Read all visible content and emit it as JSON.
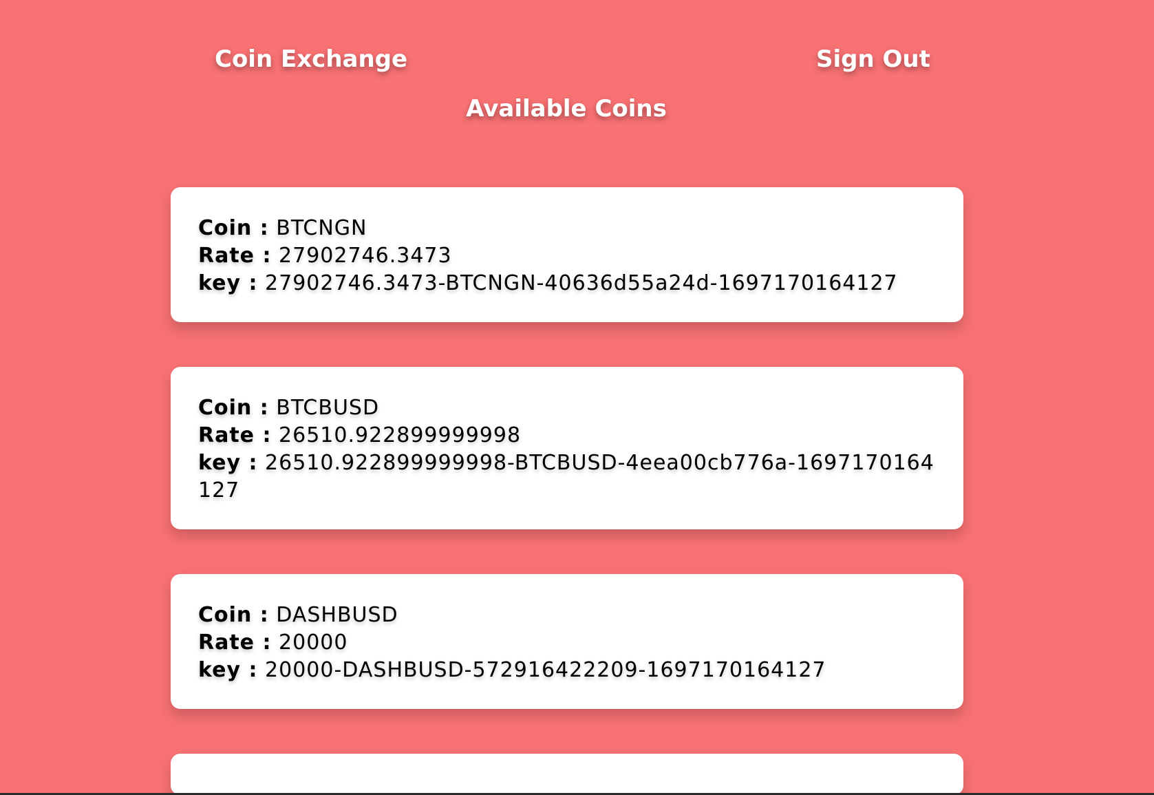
{
  "header": {
    "brand": "Coin Exchange",
    "sign_out": "Sign Out",
    "title": "Available Coins"
  },
  "labels": {
    "coin": "Coin :",
    "rate": "Rate :",
    "key": "key :"
  },
  "coins": [
    {
      "coin": "BTCNGN",
      "rate": "27902746.3473",
      "key": "27902746.3473-BTCNGN-40636d55a24d-1697170164127"
    },
    {
      "coin": "BTCBUSD",
      "rate": "26510.922899999998",
      "key": "26510.922899999998-BTCBUSD-4eea00cb776a-1697170164127"
    },
    {
      "coin": "DASHBUSD",
      "rate": "20000",
      "key": "20000-DASHBUSD-572916422209-1697170164127"
    }
  ],
  "colors": {
    "background": "#f87173",
    "card": "#ffffff",
    "header_text": "#ffffff",
    "body_text": "#000000"
  }
}
